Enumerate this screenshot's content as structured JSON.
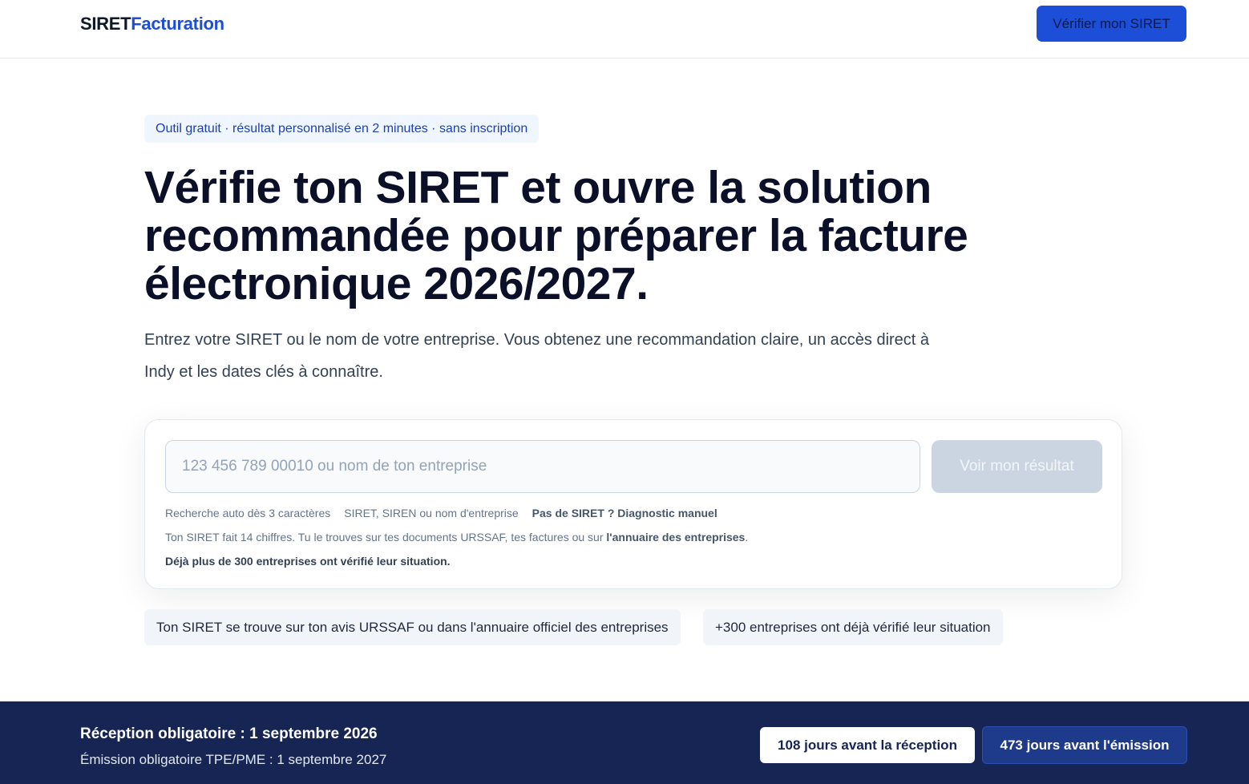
{
  "header": {
    "logo_part1": "SIRET",
    "logo_part2": "Facturation",
    "cta_label": "Vérifier mon SIRET"
  },
  "hero": {
    "pill": "Outil gratuit · résultat personnalisé en 2 minutes · sans inscription",
    "title": "Vérifie ton SIRET et ouvre la solution recommandée pour préparer la facture électronique 2026/2027.",
    "subtitle": "Entrez votre SIRET ou le nom de votre entreprise. Vous obtenez une recommandation claire, un accès direct à Indy et les dates clés à connaître."
  },
  "search": {
    "placeholder": "123 456 789 00010 ou nom de ton entreprise",
    "value": "",
    "button_label": "Voir mon résultat",
    "hint_auto": "Recherche auto dès 3 caractères",
    "hint_types": "SIRET, SIREN ou nom d'entreprise",
    "hint_manual": "Pas de SIRET ? Diagnostic manuel",
    "info_prefix": "Ton SIRET fait 14 chiffres. Tu le trouves sur tes documents URSSAF, tes factures ou sur ",
    "info_link": "l'annuaire des entreprises",
    "info_suffix": ".",
    "social_proof": "Déjà plus de 300 entreprises ont vérifié leur situation."
  },
  "chips": [
    "Ton SIRET se trouve sur ton avis URSSAF ou dans l'annuaire officiel des entreprises",
    "+300 entreprises ont déjà vérifié leur situation"
  ],
  "footer": {
    "title": "Réception obligatoire : 1 septembre 2026",
    "subtitle": "Émission obligatoire TPE/PME : 1 septembre 2027",
    "badge_reception": "108 jours avant la réception",
    "badge_emission": "473 jours avant l'émission"
  },
  "colors": {
    "accent": "#1d4ed8",
    "footer_bg": "#172554",
    "disabled_button": "#cbd5e1"
  }
}
